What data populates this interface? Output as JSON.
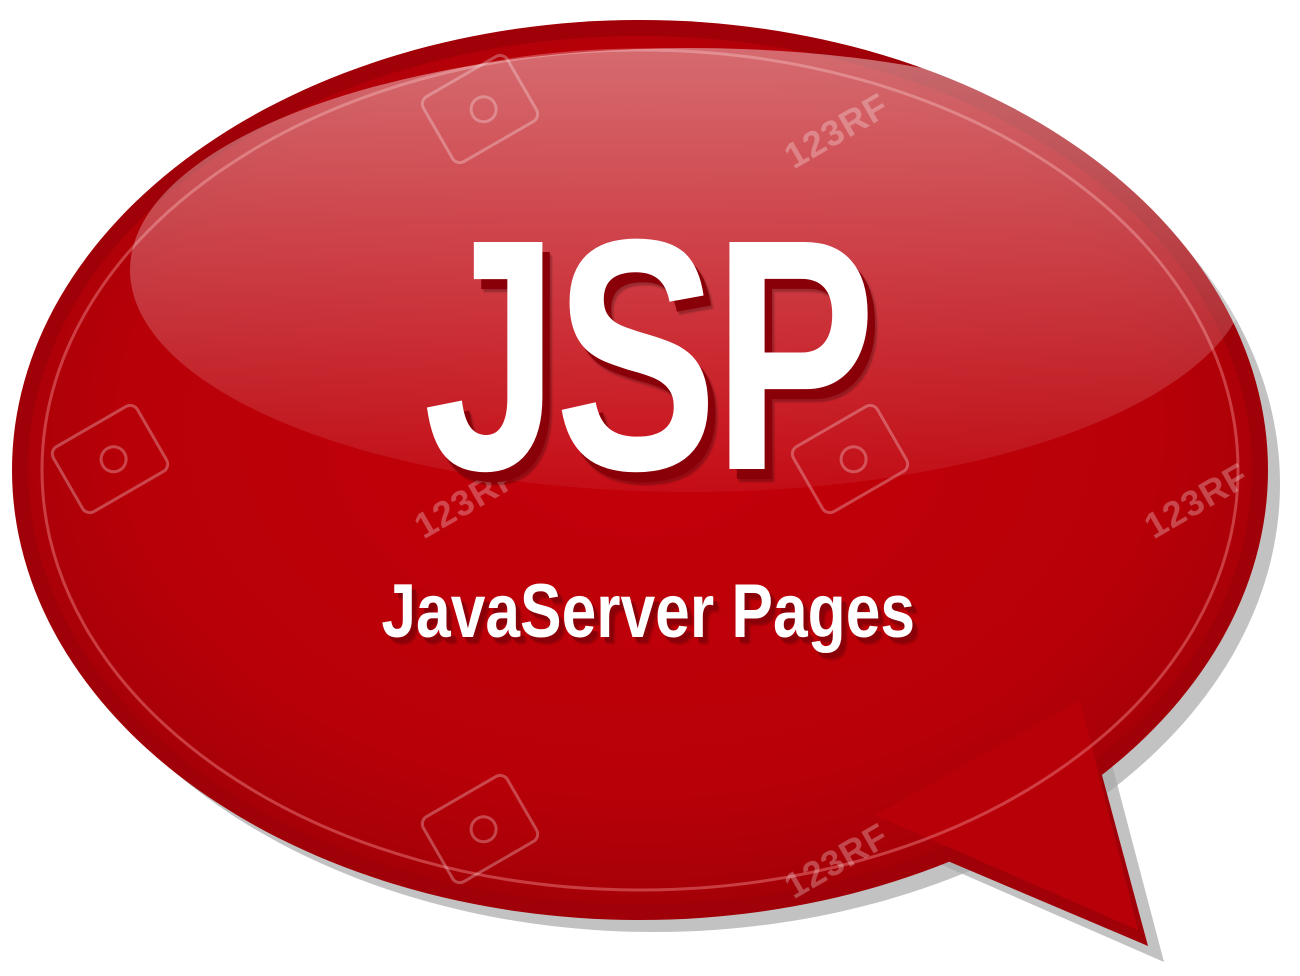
{
  "bubble": {
    "headline": "JSP",
    "subtitle": "JavaServer Pages",
    "fill_color": "#c20009",
    "dark_color": "#a80008",
    "shadow_color": "#9a9a9a"
  },
  "watermark": {
    "text": "123RF"
  }
}
